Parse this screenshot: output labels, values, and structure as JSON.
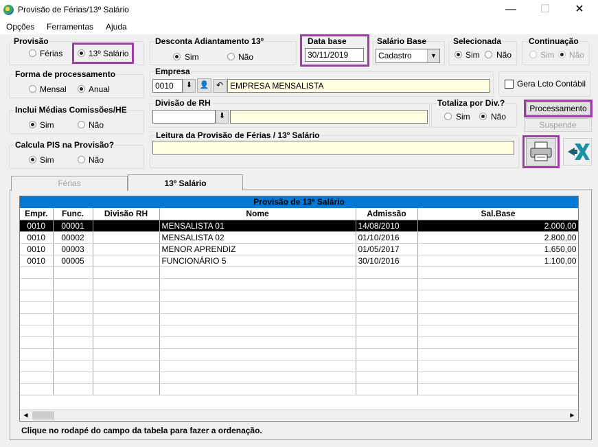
{
  "window": {
    "title": "Provisão de Férias/13º Salário"
  },
  "menu": [
    "Opções",
    "Ferramentas",
    "Ajuda"
  ],
  "provisao": {
    "label": "Provisão",
    "opt1": "Férias",
    "opt2": "13º Salário"
  },
  "desconta": {
    "label": "Desconta Adiantamento 13º",
    "sim": "Sim",
    "nao": "Não"
  },
  "data_base": {
    "label": "Data base",
    "value": "30/11/2019"
  },
  "salario_base": {
    "label": "Salário Base",
    "value": "Cadastro"
  },
  "selecionada": {
    "label": "Selecionada",
    "sim": "Sim",
    "nao": "Não"
  },
  "continuacao": {
    "label": "Continuação",
    "sim": "Sim",
    "nao": "Não"
  },
  "forma": {
    "label": "Forma de processamento",
    "mensal": "Mensal",
    "anual": "Anual"
  },
  "empresa": {
    "label": "Empresa",
    "code": "0010",
    "name": "EMPRESA MENSALISTA"
  },
  "gera_lcto": {
    "label": "Gera Lcto Contábil"
  },
  "inclui": {
    "label": "Inclui Médias Comissões/HE",
    "sim": "Sim",
    "nao": "Não"
  },
  "divisao": {
    "label": "Divisão de RH"
  },
  "totaliza": {
    "label": "Totaliza por Div.?",
    "sim": "Sim",
    "nao": "Não"
  },
  "buttons": {
    "processamento": "Processamento",
    "suspende": "Suspende"
  },
  "pis": {
    "label": "Calcula PIS na Provisão?",
    "sim": "Sim",
    "nao": "Não"
  },
  "leitura": {
    "label": "Leitura da Provisão de Férias / 13º Salário"
  },
  "tabs": [
    "Férias",
    "13º Salário"
  ],
  "grid": {
    "title": "Provisão de 13ª Salário",
    "headers": [
      "Empr.",
      "Func.",
      "Divisão RH",
      "Nome",
      "Admissão",
      "Sal.Base"
    ],
    "rows": [
      [
        "0010",
        "00001",
        "",
        "MENSALISTA 01",
        "14/08/2010",
        "2.000,00"
      ],
      [
        "0010",
        "00002",
        "",
        "MENSALISTA 02",
        "01/10/2016",
        "2.800,00"
      ],
      [
        "0010",
        "00003",
        "",
        "MENOR APRENDIZ",
        "01/05/2017",
        "1.650,00"
      ],
      [
        "0010",
        "00005",
        "",
        "FUNCIONÁRIO 5",
        "30/10/2016",
        "1.100,00"
      ]
    ]
  },
  "footer": "Clique no rodapé do campo da tabela  para fazer a ordenação.",
  "colors": {
    "highlight": "#9b3fa7",
    "grid_header": "#0078d7",
    "field_yellow": "#ffffe1"
  }
}
